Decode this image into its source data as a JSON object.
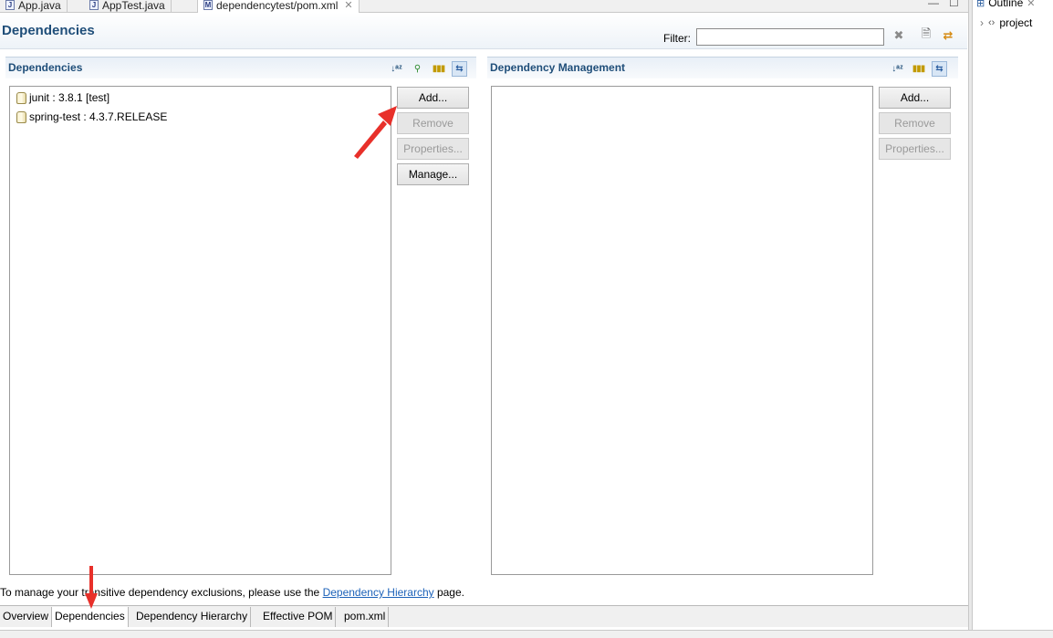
{
  "editor_tabs": [
    {
      "label": "App.java",
      "icon": "java-file-icon"
    },
    {
      "label": "AppTest.java",
      "icon": "java-file-icon"
    },
    {
      "label": "dependencytest/pom.xml",
      "icon": "maven-pom-icon",
      "active": true
    }
  ],
  "header": {
    "title": "Dependencies",
    "filter_label": "Filter:",
    "filter_value": ""
  },
  "dependencies": {
    "title": "Dependencies",
    "items": [
      {
        "label": "junit : 3.8.1 [test]"
      },
      {
        "label": "spring-test : 4.3.7.RELEASE"
      }
    ],
    "buttons": {
      "add": "Add...",
      "remove": "Remove",
      "properties": "Properties...",
      "manage": "Manage..."
    }
  },
  "dependency_management": {
    "title": "Dependency Management",
    "items": [],
    "buttons": {
      "add": "Add...",
      "remove": "Remove",
      "properties": "Properties..."
    }
  },
  "footer": {
    "text_before": "To manage your transitive dependency exclusions, please use the ",
    "link": "Dependency Hierarchy",
    "text_after": " page."
  },
  "bottom_tabs": [
    {
      "label": "Overview"
    },
    {
      "label": "Dependencies",
      "active": true
    },
    {
      "label": "Dependency Hierarchy"
    },
    {
      "label": "Effective POM"
    },
    {
      "label": "pom.xml"
    }
  ],
  "outline": {
    "title": "Outline",
    "item": "project"
  },
  "colors": {
    "title_blue": "#1f4e79",
    "link_blue": "#1c62b9",
    "annotation_red": "#e8302a"
  }
}
